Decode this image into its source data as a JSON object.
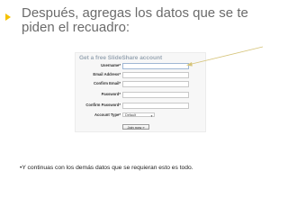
{
  "slide": {
    "heading": "Después, agregas los datos que se te piden el recuadro:",
    "body": "•Y continuas con los demás datos que se requieran esto es todo."
  },
  "form": {
    "title": "Get a free SlideShare account",
    "fields": {
      "username": "Username*",
      "email": "Email Address*",
      "confirm_email": "Confirm Email*",
      "password": "Password*",
      "confirm_password": "Confirm Password*",
      "account_type": "Account Type*"
    },
    "account_type_value": "Default",
    "join_button": "Join now »"
  },
  "colors": {
    "heading_text": "#6b6b6b",
    "bullet_accent": "#f5c200",
    "arrow": "#d6c47a"
  },
  "icons": {
    "bullet": "yellow-arrow-bullet-icon",
    "pointer": "diagonal-arrow-icon"
  }
}
